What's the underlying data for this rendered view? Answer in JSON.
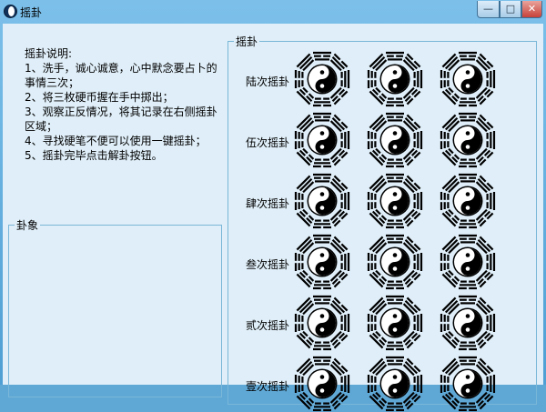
{
  "window": {
    "title": "摇卦",
    "minimize": "—",
    "maximize": "□",
    "close": "✕"
  },
  "instructions": {
    "heading": "摇卦说明:",
    "lines": [
      "1、洗手，诚心诚意，心中默念要占卜的",
      "事情三次；",
      "2、将三枚硬币握在手中掷出；",
      "3、观察正反情况，将其记录在右侧摇卦",
      "区域；",
      "4、寻找硬笔不便可以使用一键摇卦；",
      "5、摇卦完毕点击解卦按钮。"
    ]
  },
  "gua_group": {
    "title": "卦象"
  },
  "cast_group": {
    "title": "摇卦",
    "rows": [
      {
        "label": "陆次摇卦",
        "coins": [
          "bagua-taiji-icon",
          "bagua-taiji-icon",
          "bagua-taiji-icon"
        ]
      },
      {
        "label": "伍次摇卦",
        "coins": [
          "bagua-taiji-icon",
          "bagua-taiji-icon",
          "bagua-taiji-icon"
        ]
      },
      {
        "label": "肆次摇卦",
        "coins": [
          "bagua-taiji-icon",
          "bagua-taiji-icon",
          "bagua-taiji-icon"
        ]
      },
      {
        "label": "叁次摇卦",
        "coins": [
          "bagua-taiji-icon",
          "bagua-taiji-icon",
          "bagua-taiji-icon"
        ]
      },
      {
        "label": "贰次摇卦",
        "coins": [
          "bagua-taiji-icon",
          "bagua-taiji-icon",
          "bagua-taiji-icon"
        ]
      },
      {
        "label": "壹次摇卦",
        "coins": [
          "bagua-taiji-icon",
          "bagua-taiji-icon",
          "bagua-taiji-icon"
        ]
      }
    ]
  }
}
